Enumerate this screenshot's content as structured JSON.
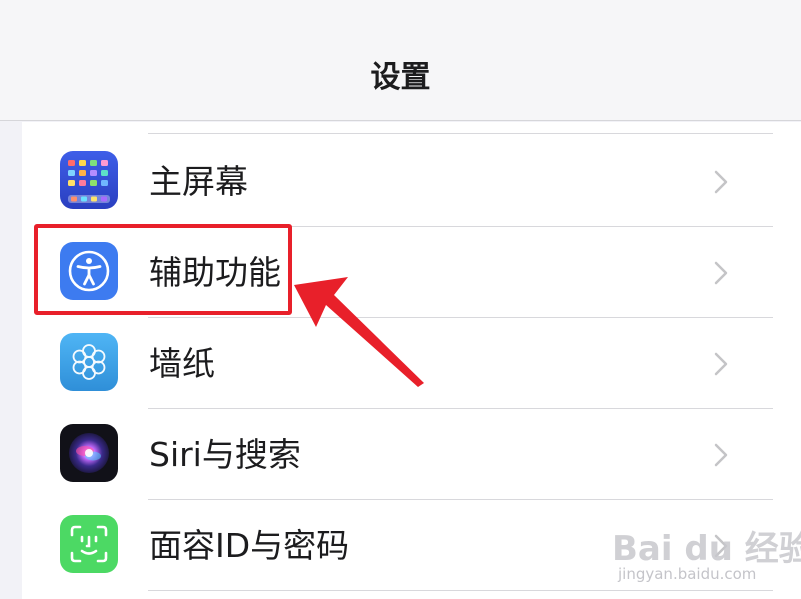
{
  "nav": {
    "title": "设置"
  },
  "settings": {
    "items": [
      {
        "label": "主屏幕",
        "icon": "home-screen-icon"
      },
      {
        "label": "辅助功能",
        "icon": "accessibility-icon"
      },
      {
        "label": "墙纸",
        "icon": "wallpaper-icon"
      },
      {
        "label": "Siri与搜索",
        "icon": "siri-icon"
      },
      {
        "label": "面容ID与密码",
        "icon": "face-id-icon"
      }
    ]
  },
  "annotation": {
    "highlighted_item": "辅助功能",
    "box_color": "#e8202a",
    "arrow_color": "#e8202a"
  },
  "watermark": {
    "brand": "Bai du 经验",
    "url": "jingyan.baidu.com"
  },
  "colors": {
    "background": "#f2f2f7",
    "nav_background": "#f6f6f8",
    "list_background": "#ffffff",
    "chevron": "#c4c4c7"
  }
}
